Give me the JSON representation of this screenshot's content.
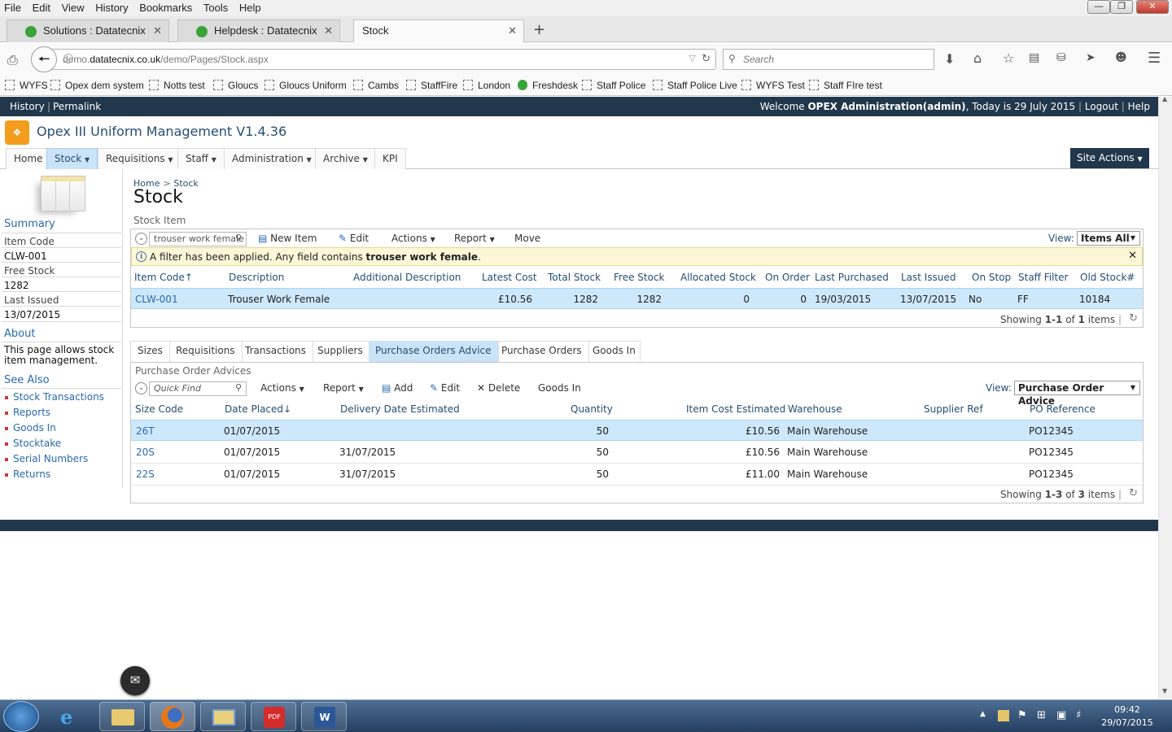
{
  "browser": {
    "menu": [
      "File",
      "Edit",
      "View",
      "History",
      "Bookmarks",
      "Tools",
      "Help"
    ],
    "tabs": [
      {
        "label": "Solutions : Datatecnix",
        "active": false
      },
      {
        "label": "Helpdesk : Datatecnix",
        "active": false
      },
      {
        "label": "Stock",
        "active": true
      }
    ],
    "url_prefix": "demo.",
    "url_domain": "datatecnix.co.uk",
    "url_path": "/demo/Pages/Stock.aspx",
    "search_placeholder": "Search",
    "bookmarks": [
      "WYFS",
      "Opex dem system",
      "Notts test",
      "Gloucs",
      "Gloucs Uniform",
      "Cambs",
      "StaffFire",
      "London",
      "Freshdesk",
      "Staff Police",
      "Staff Police Live",
      "WYFS Test",
      "Staff FIre test"
    ]
  },
  "topbar": {
    "history": "History",
    "permalink": "Permalink",
    "welcome_prefix": "Welcome ",
    "welcome_user": "OPEX Administration(admin)",
    "welcome_suffix": ", Today is 29 July 2015",
    "logout": "Logout",
    "help": "Help"
  },
  "app": {
    "title": "Opex III Uniform Management V1.4.36",
    "nav": [
      {
        "label": "Home",
        "dropdown": false,
        "selected": false
      },
      {
        "label": "Stock",
        "dropdown": true,
        "selected": true
      },
      {
        "label": "Requisitions",
        "dropdown": true,
        "selected": false
      },
      {
        "label": "Staff",
        "dropdown": true,
        "selected": false
      },
      {
        "label": "Administration",
        "dropdown": true,
        "selected": false
      },
      {
        "label": "Archive",
        "dropdown": true,
        "selected": false
      },
      {
        "label": "KPI",
        "dropdown": false,
        "selected": false
      }
    ],
    "site_actions": "Site Actions"
  },
  "sidebar": {
    "summary_heading": "Summary",
    "fields": [
      {
        "label": "Item Code",
        "value": "CLW-001"
      },
      {
        "label": "Free Stock",
        "value": "1282"
      },
      {
        "label": "Last Issued",
        "value": "13/07/2015"
      }
    ],
    "about_heading": "About",
    "about_text": "This page allows stock item management.",
    "see_also_heading": "See Also",
    "links": [
      "Stock Transactions",
      "Reports",
      "Goods In",
      "Stocktake",
      "Serial Numbers",
      "Returns"
    ]
  },
  "main": {
    "breadcrumb_home": "Home",
    "breadcrumb_sep": ">",
    "breadcrumb_current": "Stock",
    "page_title": "Stock",
    "section_label": "Stock Item",
    "toolbar": {
      "filter_value": "trouser work female",
      "new_item": "New Item",
      "edit": "Edit",
      "actions": "Actions",
      "report": "Report",
      "move": "Move",
      "view_label": "View:",
      "view_value": "Items All"
    },
    "filter_notice_prefix": "A filter has been applied. Any field contains ",
    "filter_notice_term": "trouser work female",
    "filter_notice_suffix": ".",
    "columns": [
      "Item Code↑",
      "Description",
      "Additional Description",
      "Latest Cost",
      "Total Stock",
      "Free Stock",
      "Allocated Stock",
      "On Order",
      "Last Purchased",
      "Last Issued",
      "On Stop",
      "Staff Filter",
      "Old Stock#"
    ],
    "rows": [
      [
        "CLW-001",
        "Trouser Work Female",
        "",
        "£10.56",
        "1282",
        "1282",
        "0",
        "0",
        "19/03/2015",
        "13/07/2015",
        "No",
        "FF",
        "10184"
      ]
    ],
    "showing_prefix": "Showing ",
    "showing_range": "1-1",
    "showing_of": " of ",
    "showing_total": "1",
    "showing_suffix": " items"
  },
  "subpanel": {
    "tabs": [
      {
        "label": "Sizes",
        "selected": false
      },
      {
        "label": "Requisitions",
        "selected": false
      },
      {
        "label": "Transactions",
        "selected": false
      },
      {
        "label": "Suppliers",
        "selected": false
      },
      {
        "label": "Purchase Orders Advice",
        "selected": true
      },
      {
        "label": "Purchase Orders",
        "selected": false
      },
      {
        "label": "Goods In",
        "selected": false
      }
    ],
    "section_label": "Purchase Order Advices",
    "toolbar": {
      "quick_find": "Quick Find",
      "actions": "Actions",
      "report": "Report",
      "add": "Add",
      "edit": "Edit",
      "delete": "Delete",
      "goods_in": "Goods In",
      "view_label": "View:",
      "view_value": "Purchase Order Advice"
    },
    "columns": [
      "Size Code",
      "Date Placed↓",
      "Delivery Date Estimated",
      "Quantity",
      "Item Cost Estimated",
      "Warehouse",
      "Supplier Ref",
      "PO Reference"
    ],
    "rows": [
      [
        "26T",
        "01/07/2015",
        "",
        "50",
        "£10.56",
        "Main Warehouse",
        "",
        "PO12345"
      ],
      [
        "20S",
        "01/07/2015",
        "31/07/2015",
        "50",
        "£10.56",
        "Main Warehouse",
        "",
        "PO12345"
      ],
      [
        "22S",
        "01/07/2015",
        "31/07/2015",
        "50",
        "£11.00",
        "Main Warehouse",
        "",
        "PO12345"
      ]
    ],
    "showing_prefix": "Showing ",
    "showing_range": "1-3",
    "showing_of": " of ",
    "showing_total": "3",
    "showing_suffix": " items"
  },
  "taskbar": {
    "time": "09:42",
    "date": "29/07/2015"
  }
}
